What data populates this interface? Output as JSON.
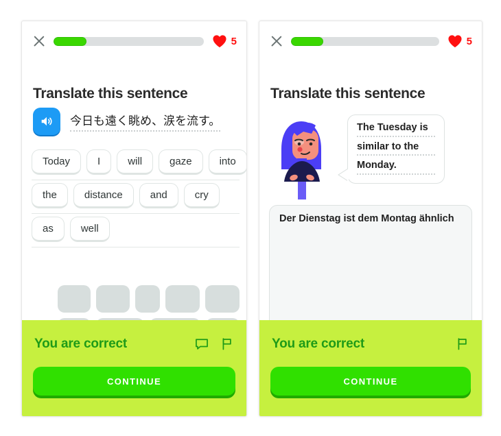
{
  "colors": {
    "progress_fill": "#3ad700",
    "progress_track": "#dcdfe0",
    "heart": "#ff1010",
    "speaker_blue": "#1d9bf5",
    "banner_bg": "#c6f03f",
    "banner_text": "#1f9b18",
    "continue_button": "#30e000",
    "hair": "#4b3ef5",
    "skin": "#f4907e",
    "shirt": "#1b1b4e"
  },
  "left_panel": {
    "header": {
      "close_label": "close",
      "progress_percent": 22,
      "hearts_count": "5"
    },
    "title": "Translate this sentence",
    "prompt": {
      "speaker_label": "play audio",
      "sentence": "今日も遠く眺め、涙を流す。"
    },
    "word_tiles": [
      [
        "Today",
        "I",
        "will",
        "gaze",
        "into"
      ],
      [
        "the",
        "distance",
        "and",
        "cry"
      ],
      [
        "as",
        "well"
      ]
    ],
    "ghost_rows": [
      [
        58,
        58,
        44,
        60,
        60
      ],
      [
        58,
        85,
        90,
        60
      ]
    ],
    "banner": {
      "message": "You are correct",
      "icons": [
        "speech-bubble-icon",
        "flag-icon"
      ],
      "continue_label": "CONTINUE"
    }
  },
  "right_panel": {
    "header": {
      "close_label": "close",
      "progress_percent": 22,
      "hearts_count": "5"
    },
    "title": "Translate this sentence",
    "bubble_lines": [
      "The Tuesday is",
      "similar to the",
      "Monday."
    ],
    "answer_text": "Der Dienstag ist dem Montag ähnlich",
    "banner": {
      "message": "You are correct",
      "icons": [
        "flag-icon"
      ],
      "continue_label": "CONTINUE"
    }
  }
}
